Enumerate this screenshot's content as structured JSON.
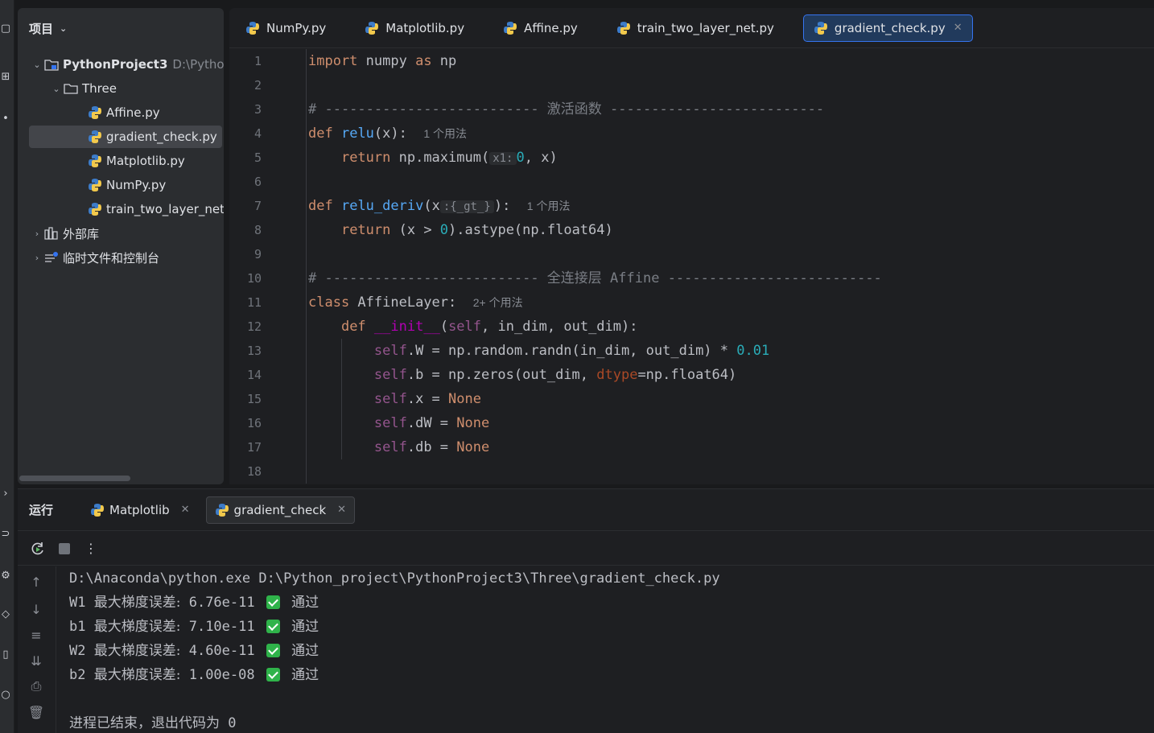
{
  "colors": {
    "accent": "#3574f0",
    "selected_tab_bg": "#213a5c",
    "check_green": "#2fb34a",
    "keyword": "#cf8e6d",
    "function": "#56a8f5",
    "number": "#2aacb8",
    "self": "#94558d"
  },
  "project": {
    "header": "项目",
    "header_icon": "chevron-down-icon",
    "root": {
      "name": "PythonProject3",
      "path": "D:\\Pythor"
    },
    "folder": "Three",
    "files": [
      "Affine.py",
      "gradient_check.py",
      "Matplotlib.py",
      "NumPy.py",
      "train_two_layer_net."
    ],
    "selected_file": "gradient_check.py",
    "external_libs": "外部库",
    "scratches": "临时文件和控制台"
  },
  "editor": {
    "tabs": [
      {
        "label": "NumPy.py"
      },
      {
        "label": "Matplotlib.py"
      },
      {
        "label": "Affine.py"
      },
      {
        "label": "train_two_layer_net.py"
      },
      {
        "label": "gradient_check.py",
        "active": true
      }
    ],
    "line_numbers": [
      "1",
      "2",
      "3",
      "4",
      "5",
      "6",
      "7",
      "8",
      "9",
      "10",
      "11",
      "12",
      "13",
      "14",
      "15",
      "16",
      "17",
      "18"
    ],
    "code": {
      "l1": {
        "a": "import",
        "b": " numpy ",
        "c": "as",
        "d": " np"
      },
      "l3": "# -------------------------- 激活函数 --------------------------",
      "l4": {
        "def": "def",
        "name": "relu",
        "args": "(x):",
        "hint": "1 个用法"
      },
      "l5": {
        "ret": "return",
        "body1": " np.maximum(",
        "inlay": "x1:",
        "num": "0",
        "body2": ", x)"
      },
      "l7": {
        "def": "def",
        "name": "relu_deriv",
        "args1": "(x",
        "inlay": ":{_gt_}",
        "args2": "):",
        "hint": "1 个用法"
      },
      "l8": {
        "ret": "return",
        "body1": " (x > ",
        "num": "0",
        "body2": ").astype(np.float64)"
      },
      "l10": "# -------------------------- 全连接层 Affine --------------------------",
      "l11": {
        "cls": "class",
        "name": " AffineLayer:",
        "hint": "2+ 个用法"
      },
      "l12": {
        "def": "def",
        "name": "__init__",
        "p1": "(",
        "self": "self",
        "rest": ", in_dim, out_dim):"
      },
      "l13": {
        "self": "self",
        "body": ".W = np.random.randn(in_dim, out_dim) * ",
        "num": "0.01"
      },
      "l14": {
        "self": "self",
        "body": ".b = np.zeros(out_dim, ",
        "param": "dtype",
        "rest": "=np.float64)"
      },
      "l15": {
        "self": "self",
        "body": ".x = ",
        "none": "None"
      },
      "l16": {
        "self": "self",
        "body": ".dW = ",
        "none": "None"
      },
      "l17": {
        "self": "self",
        "body": ".db = ",
        "none": "None"
      }
    }
  },
  "run": {
    "title": "运行",
    "tabs": [
      {
        "label": "Matplotlib"
      },
      {
        "label": "gradient_check",
        "active": true
      }
    ],
    "output": {
      "cmd": "D:\\Anaconda\\python.exe D:\\Python_project\\PythonProject3\\Three\\gradient_check.py",
      "rows": [
        {
          "name": "W1",
          "label": "最大梯度误差:",
          "value": "6.76e-11",
          "status": "通过"
        },
        {
          "name": "b1",
          "label": "最大梯度误差:",
          "value": "7.10e-11",
          "status": "通过"
        },
        {
          "name": "W2",
          "label": "最大梯度误差:",
          "value": "4.60e-11",
          "status": "通过"
        },
        {
          "name": "b2",
          "label": "最大梯度误差:",
          "value": "1.00e-08",
          "status": "通过"
        }
      ],
      "exit": "进程已结束，退出代码为 0"
    }
  }
}
